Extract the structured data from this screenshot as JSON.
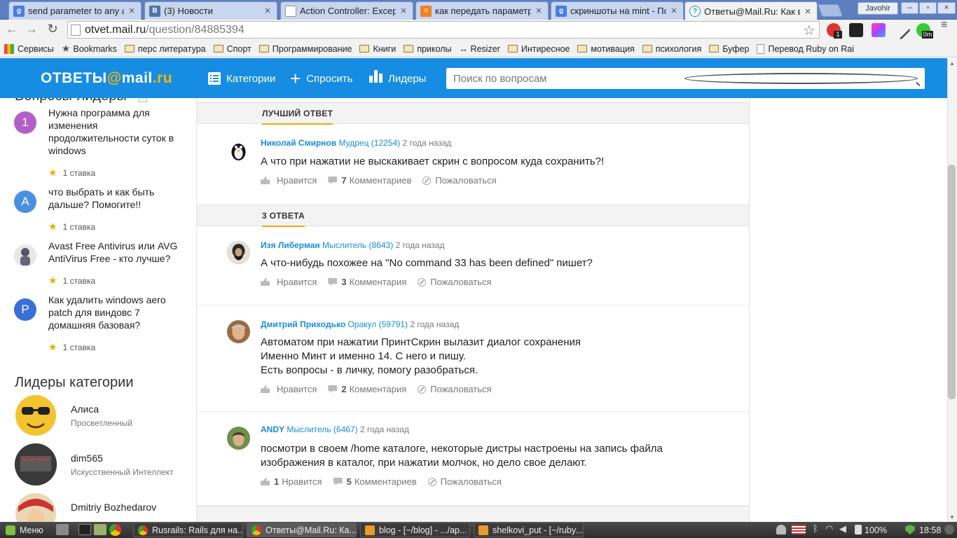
{
  "browser": {
    "tabs": [
      {
        "title": "send parameter to any a",
        "icon": "google-icon",
        "color": "#4a7de2"
      },
      {
        "title": "(3) Новости",
        "icon": "vk-icon",
        "color": "#4b76a8"
      },
      {
        "title": "Action Controller: Except",
        "icon": "page-icon",
        "color": "#888888"
      },
      {
        "title": "как передать параметр",
        "icon": "stackoverflow-icon",
        "color": "#f48024"
      },
      {
        "title": "скриншоты на mint - По",
        "icon": "google-icon",
        "color": "#4a7de2"
      },
      {
        "title": "Ответы@Mail.Ru: Как в",
        "icon": "mailru-answers-icon",
        "color": "#168de2"
      }
    ],
    "profile_name": "Javohir",
    "url_host": "otvet.mail.ru",
    "url_path": "/question/84885394",
    "ext_badge_1": "1",
    "ext_badge_2": "0m",
    "bookmarks": [
      {
        "label": "Сервисы",
        "icon": "apps-icon"
      },
      {
        "label": "Bookmarks",
        "icon": "star-icon"
      },
      {
        "label": "перс литература",
        "icon": "folder-icon"
      },
      {
        "label": "Спорт",
        "icon": "folder-icon"
      },
      {
        "label": "Программирование",
        "icon": "folder-icon"
      },
      {
        "label": "Книги",
        "icon": "folder-icon"
      },
      {
        "label": "приколы",
        "icon": "folder-icon"
      },
      {
        "label": "↔ Resizer",
        "icon": "none"
      },
      {
        "label": "Интиресное",
        "icon": "folder-icon"
      },
      {
        "label": "мотивация",
        "icon": "folder-icon"
      },
      {
        "label": "психология",
        "icon": "folder-icon"
      },
      {
        "label": "Буфер",
        "icon": "folder-icon"
      },
      {
        "label": "Перевод Ruby on Rai",
        "icon": "page-icon"
      }
    ]
  },
  "site": {
    "logo_left": "ОТВЕТЫ",
    "logo_at": "@",
    "logo_right": "mail",
    "logo_dot": ".",
    "logo_ru": "ru",
    "nav": {
      "categories": "Категории",
      "ask": "Спросить",
      "leaders": "Лидеры"
    },
    "search_placeholder": "Поиск по вопросам",
    "brand_color": "#168de2",
    "accent_color": "#f5a600"
  },
  "sidebar": {
    "top_questions_title": "Вопросы-лидеры",
    "questions": [
      {
        "avatar_letter": "1",
        "avatar_color": "#b260c9",
        "text": "Нужна программа для изменения продолжительности суток в windows",
        "stake": "1 ставка"
      },
      {
        "avatar_letter": "A",
        "avatar_color": "#4a90e2",
        "text": "что выбрать и как быть дальше? Помогите!!",
        "stake": "1 ставка"
      },
      {
        "avatar_letter": "",
        "avatar_color": "#dddddd",
        "text": "Avast Free Antivirus или AVG AntiVirus Free - кто лучше?",
        "stake": "1 ставка"
      },
      {
        "avatar_letter": "P",
        "avatar_color": "#3a6fd8",
        "text": "Как удалить windows aero patch для виндовс 7 домашняя базовая?",
        "stake": "1 ставка"
      }
    ],
    "leaders_title": "Лидеры категории",
    "leaders": [
      {
        "name": "Алиса",
        "rank": "Просветленный"
      },
      {
        "name": "dim565",
        "rank": "Искусственный Интеллект"
      },
      {
        "name": "Dmitriy Bozhedarov",
        "rank": ""
      }
    ]
  },
  "best_answer": {
    "section_label": "ЛУЧШИЙ ОТВЕТ",
    "author": "Николай Смирнов",
    "rank": "Мудрец (12254)",
    "time": "2 года назад",
    "text": "А что при нажатии не выскакивает скрин с вопросом куда сохранить?!",
    "like_label": "Нравится",
    "like_count": "",
    "comment_count": "7",
    "comment_label": "Комментариев",
    "report_label": "Пожаловаться"
  },
  "answers_section": {
    "section_label": "3 ОТВЕТА",
    "answers": [
      {
        "author": "Изя Либерман",
        "rank": "Мыслитель (8643)",
        "time": "2 года назад",
        "lines": [
          "А что-нибудь похожее на \"No command 33 has been defined\" пишет?"
        ],
        "like_count": "",
        "like_label": "Нравится",
        "comment_count": "3",
        "comment_label": "Комментария",
        "report_label": "Пожаловаться"
      },
      {
        "author": "Дмитрий Приходько",
        "rank": "Оракул (59791)",
        "time": "2 года назад",
        "lines": [
          "Автоматом при нажатии ПринтСкрин вылазит диалог сохранения",
          "Именно Минт и именно 14. С него и пишу.",
          "Есть вопросы - в личку, помогу разобраться."
        ],
        "like_count": "",
        "like_label": "Нравится",
        "comment_count": "2",
        "comment_label": "Комментария",
        "report_label": "Пожаловаться"
      },
      {
        "author": "ANDY",
        "rank": "Мыслитель (6467)",
        "time": "2 года назад",
        "lines": [
          "посмотри в своем /home каталоге, некоторые дистры настроены на запись файла",
          "изображения в каталог, при нажатии молчок, но дело свое делают."
        ],
        "like_count": "1",
        "like_label": "Нравится",
        "comment_count": "5",
        "comment_label": "Комментариев",
        "report_label": "Пожаловаться"
      }
    ]
  },
  "taskbar": {
    "menu_label": "Меню",
    "windows": [
      {
        "title": "Rusrails: Rails для на..."
      },
      {
        "title": "Ответы@Mail.Ru: Ка..."
      },
      {
        "title": "blog - [~/blog] - .../ap..."
      },
      {
        "title": "shelkovi_put - [~/ruby..."
      }
    ],
    "battery": "100%",
    "clock": "18:58"
  }
}
